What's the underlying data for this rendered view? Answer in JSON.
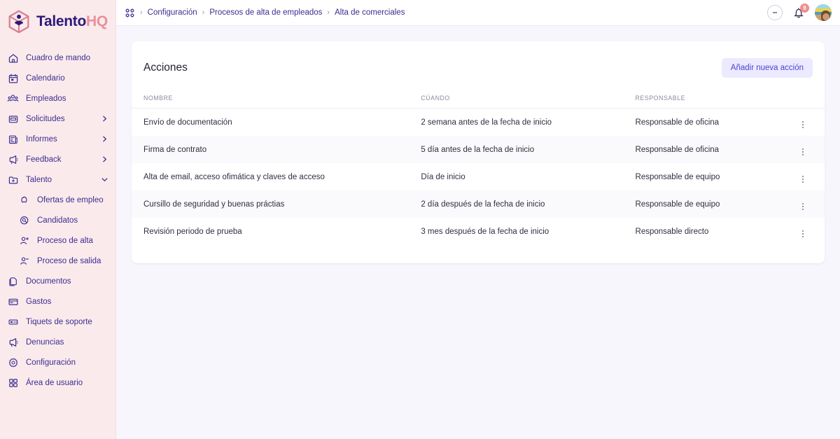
{
  "brand": {
    "name_part1": "Talento",
    "name_part2": "HQ",
    "logo_icon": "cube-person-logo"
  },
  "sidebar": {
    "items": [
      {
        "label": "Cuadro de mando",
        "icon": "home-icon",
        "chevron": "",
        "sub": false
      },
      {
        "label": "Calendario",
        "icon": "calendar-icon",
        "chevron": "",
        "sub": false
      },
      {
        "label": "Empleados",
        "icon": "people-icon",
        "chevron": "",
        "sub": false
      },
      {
        "label": "Solicitudes",
        "icon": "inbox-icon",
        "chevron": "right",
        "sub": false
      },
      {
        "label": "Informes",
        "icon": "report-icon",
        "chevron": "right",
        "sub": false
      },
      {
        "label": "Feedback",
        "icon": "megaphone-icon",
        "chevron": "right",
        "sub": false
      },
      {
        "label": "Talento",
        "icon": "folder-plus-icon",
        "chevron": "down",
        "sub": false
      },
      {
        "label": "Ofertas de empleo",
        "icon": "puzzle-icon",
        "chevron": "",
        "sub": true
      },
      {
        "label": "Candidatos",
        "icon": "search-circle-icon",
        "chevron": "",
        "sub": true
      },
      {
        "label": "Proceso de alta",
        "icon": "user-plus-icon",
        "chevron": "",
        "sub": true
      },
      {
        "label": "Proceso de salida",
        "icon": "user-minus-icon",
        "chevron": "",
        "sub": true
      },
      {
        "label": "Documentos",
        "icon": "documents-icon",
        "chevron": "",
        "sub": false
      },
      {
        "label": "Gastos",
        "icon": "card-icon",
        "chevron": "",
        "sub": false
      },
      {
        "label": "Tiquets de soporte",
        "icon": "ticket-icon",
        "chevron": "",
        "sub": false
      },
      {
        "label": "Denuncias",
        "icon": "megaphone-icon",
        "chevron": "",
        "sub": false
      },
      {
        "label": "Configuración",
        "icon": "gear-icon",
        "chevron": "",
        "sub": false
      },
      {
        "label": "Área de usuario",
        "icon": "grid-icon",
        "chevron": "",
        "sub": false
      }
    ]
  },
  "topbar": {
    "apps_icon": "grid-icon",
    "breadcrumbs": [
      "Configuración",
      "Procesos de alta de empleados",
      "Alta de comerciales"
    ],
    "separator": "›",
    "kebab_icon": "more-vertical-icon",
    "bell_icon": "bell-icon",
    "notification_count": "9",
    "avatar_icon": "user-avatar"
  },
  "card": {
    "title": "Acciones",
    "add_button_label": "Añadir nueva acción",
    "table": {
      "columns": [
        "NOMBRE",
        "CÚANDO",
        "RESPONSABLE",
        ""
      ],
      "rows": [
        {
          "nombre": "Envío de documentación",
          "cuando": "2 semana antes de la fecha de inicio",
          "responsable": "Responsable de oficina",
          "menu_icon": "more-vertical-icon"
        },
        {
          "nombre": "Firma de contrato",
          "cuando": "5 día antes de la fecha de inicio",
          "responsable": "Responsable de oficina",
          "menu_icon": "more-vertical-icon"
        },
        {
          "nombre": "Alta de email, acceso ofimática y claves de acceso",
          "cuando": "Día de inicio",
          "responsable": "Responsable de equipo",
          "menu_icon": "more-vertical-icon"
        },
        {
          "nombre": "Cursillo de seguridad y buenas práctias",
          "cuando": "2 día después de la fecha de inicio",
          "responsable": "Responsable de equipo",
          "menu_icon": "more-vertical-icon"
        },
        {
          "nombre": "Revisión periodo de prueba",
          "cuando": "3 mes después de la fecha de inicio",
          "responsable": "Responsable directo",
          "menu_icon": "more-vertical-icon"
        }
      ]
    }
  },
  "colors": {
    "sidebar_bg": "#fbeaec",
    "brand_dark": "#2b1a7a",
    "brand_pink": "#e8909c",
    "nav_text": "#3b2d8f",
    "accent": "#4b3fd4",
    "accent_soft": "#eceaff",
    "badge": "#ef8d8d",
    "page_bg": "#f7f6fc"
  }
}
